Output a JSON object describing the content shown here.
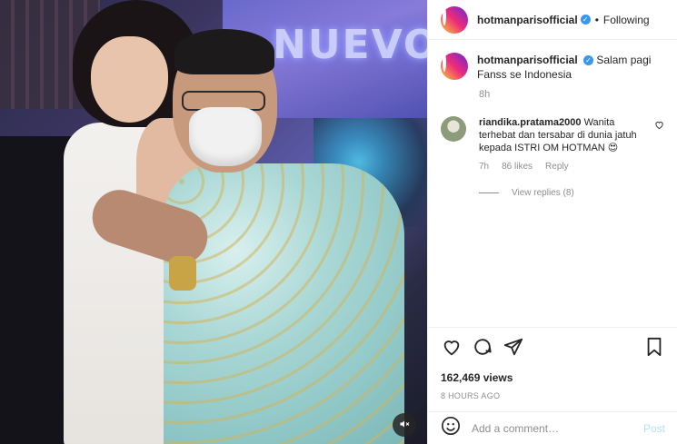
{
  "post": {
    "username": "hotmanparisofficial",
    "follow_status": "Following",
    "caption": "Salam pagi Fanss se Indonesia",
    "caption_time": "8h",
    "views": "162,469 views",
    "posted_ago": "8 HOURS AGO",
    "media": {
      "video_text": "NUEVO"
    }
  },
  "comments": [
    {
      "username": "riandika.pratama2000",
      "text": "Wanita terhebat dan tersabar di dunia jatuh kepada ISTRI OM HOTMAN 😍",
      "time": "7h",
      "likes": "86 likes",
      "reply_label": "Reply",
      "view_replies": "View replies (8)"
    }
  ],
  "add_comment": {
    "placeholder": "Add a comment…",
    "post_label": "Post"
  },
  "icons": {
    "like": "heart-icon",
    "comment": "comment-icon",
    "share": "share-icon",
    "save": "bookmark-icon",
    "emoji": "emoji-icon",
    "mute": "mute-icon",
    "verified": "verified-badge-icon"
  },
  "colors": {
    "verified": "#3897f0",
    "post_button_disabled": "#b2dffc",
    "secondary_text": "#8e8e8e"
  }
}
